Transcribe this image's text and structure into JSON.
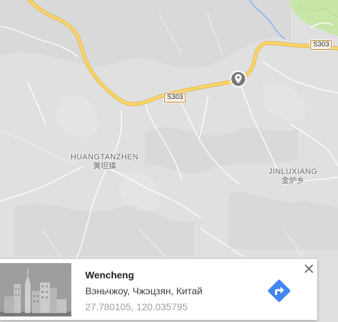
{
  "map": {
    "places": [
      {
        "latin": "HUANGTANZHEN",
        "native": "黄坦镇"
      },
      {
        "latin": "JINLUXIANG",
        "native": "金炉乡"
      }
    ],
    "road_shields": [
      "S303",
      "S303"
    ],
    "marker_icon": "location-pin-icon",
    "colors": {
      "land": "#e0e0e0",
      "highway": "#f9d66b",
      "highway_casing": "#e8b84a",
      "minor_road": "#ffffff",
      "park": "#c8e6a8",
      "water": "#8ab4f8",
      "marker": "#7a7a7a"
    }
  },
  "info_card": {
    "title": "Wencheng",
    "address": "Вэньчжоу, Чжэцзян, Китай",
    "coordinates": "27.780105, 120.035795",
    "close_icon": "close-icon",
    "directions_icon": "directions-icon",
    "accent": "#4285f4"
  }
}
